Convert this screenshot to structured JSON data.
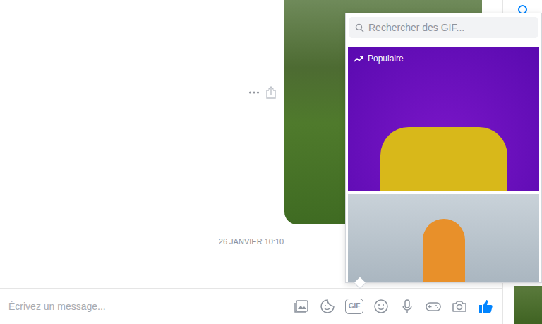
{
  "conversation": {
    "timestamp": "26 JANVIER 10:10"
  },
  "composer": {
    "placeholder": "Écrivez un message...",
    "gif_button": {
      "label": "GIF"
    }
  },
  "gif_picker": {
    "search": {
      "placeholder": "Rechercher des GIF..."
    },
    "section": "Populaire"
  }
}
